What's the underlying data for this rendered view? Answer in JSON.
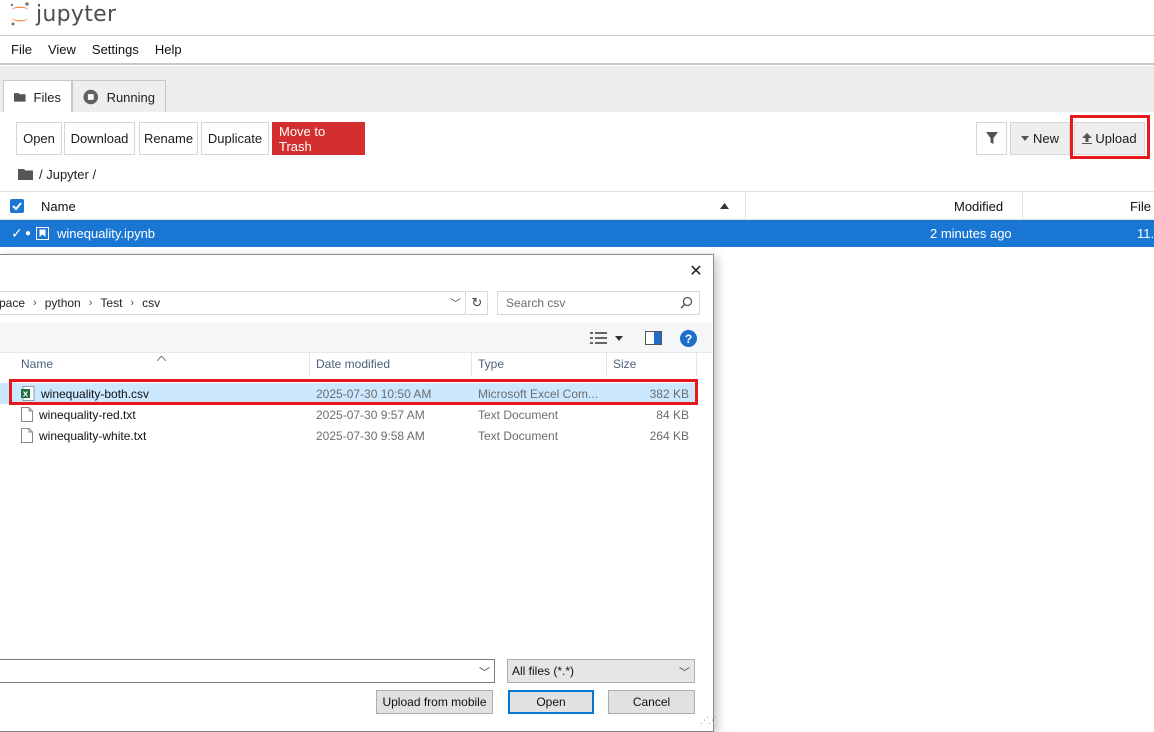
{
  "app": {
    "name": "jupyter"
  },
  "menu": [
    "File",
    "View",
    "Settings",
    "Help"
  ],
  "tabs": [
    {
      "label": "Files",
      "icon": "folder-icon",
      "active": true
    },
    {
      "label": "Running",
      "icon": "stop-circle-icon",
      "active": false
    }
  ],
  "toolbar": {
    "open": "Open",
    "download": "Download",
    "rename": "Rename",
    "duplicate": "Duplicate",
    "trash": "Move to Trash",
    "new": "New",
    "upload": "Upload"
  },
  "breadcrumb": "/ Jupyter /",
  "file_list": {
    "headers": {
      "name": "Name",
      "modified": "Modified",
      "size": "File"
    },
    "rows": [
      {
        "name": "winequality.ipynb",
        "modified": "2 minutes ago",
        "size": "11.",
        "selected": true
      }
    ]
  },
  "dialog": {
    "path": [
      "pace",
      "python",
      "Test",
      "csv"
    ],
    "search_placeholder": "Search csv",
    "headers": {
      "name": "Name",
      "date": "Date modified",
      "type": "Type",
      "size": "Size"
    },
    "files": [
      {
        "name": "winequality-both.csv",
        "date": "2025-07-30 10:50 AM",
        "type": "Microsoft Excel Com...",
        "size": "382 KB",
        "icon": "excel-csv-icon",
        "selected": true
      },
      {
        "name": "winequality-red.txt",
        "date": "2025-07-30 9:57 AM",
        "type": "Text Document",
        "size": "84 KB",
        "icon": "text-file-icon",
        "selected": false
      },
      {
        "name": "winequality-white.txt",
        "date": "2025-07-30 9:58 AM",
        "type": "Text Document",
        "size": "264 KB",
        "icon": "text-file-icon",
        "selected": false
      }
    ],
    "filename_value": "",
    "filetype": "All files (*.*)",
    "buttons": {
      "mobile": "Upload from mobile",
      "open": "Open",
      "cancel": "Cancel"
    }
  },
  "colors": {
    "jupyter_orange": "#f37726",
    "selection_blue": "#1976d2",
    "danger_red": "#d32f2f",
    "highlight_red": "#e5191c",
    "win_select": "#cce8ff"
  }
}
